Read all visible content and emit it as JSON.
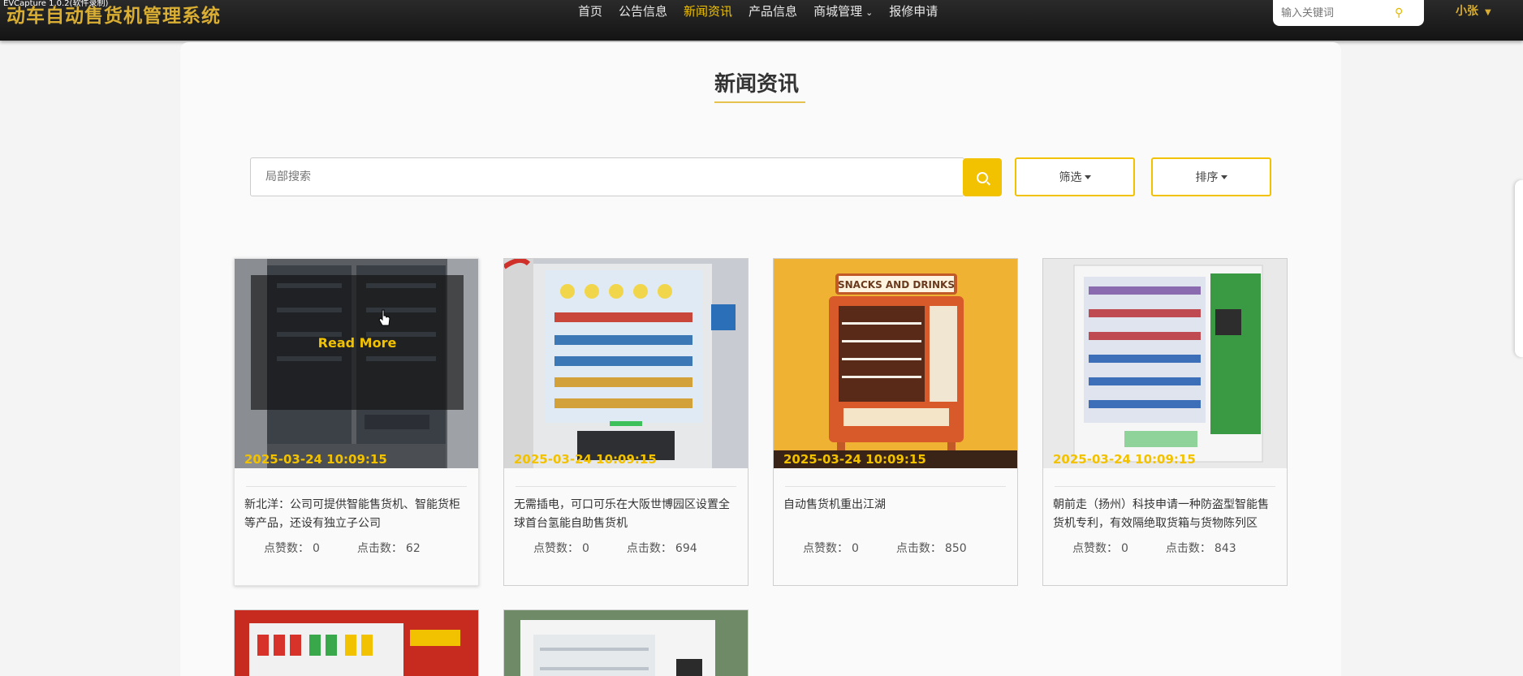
{
  "overlay": {
    "caption": "EVCapture 1.0.2(软件录制)"
  },
  "header": {
    "brand": "动车自动售货机管理系统",
    "nav": [
      {
        "label": "首页"
      },
      {
        "label": "公告信息"
      },
      {
        "label": "新闻资讯"
      },
      {
        "label": "产品信息"
      },
      {
        "label": "商城管理"
      },
      {
        "label": "报修申请"
      }
    ],
    "search_placeholder": "输入关键词",
    "user": "小张"
  },
  "page": {
    "title": "新闻资讯",
    "search_placeholder": "局部搜索",
    "filter_label": "筛选",
    "sort_label": "排序"
  },
  "cards": [
    {
      "date": "2025-03-24 10:09:15",
      "title": "新北洋：公司可提供智能售货机、智能货柜等产品，还设有独立子公司",
      "likes_label": "点赞数：",
      "likes": "0",
      "clicks_label": "点击数：",
      "clicks": "62",
      "hover_text": "Read More"
    },
    {
      "date": "2025-03-24 10:09:15",
      "title": "无需插电，可口可乐在大阪世博园区设置全球首台氢能自助售货机",
      "likes_label": "点赞数：",
      "likes": "0",
      "clicks_label": "点击数：",
      "clicks": "694"
    },
    {
      "date": "2025-03-24 10:09:15",
      "title": "自动售货机重出江湖",
      "likes_label": "点赞数：",
      "likes": "0",
      "clicks_label": "点击数：",
      "clicks": "850",
      "image_text": "SNACKS AND DRINKS"
    },
    {
      "date": "2025-03-24 10:09:15",
      "title": "朝前走（扬州）科技申请一种防盗型智能售货机专利，有效隔绝取货箱与货物陈列区",
      "likes_label": "点赞数：",
      "likes": "0",
      "clicks_label": "点击数：",
      "clicks": "843"
    }
  ],
  "colors": {
    "accent": "#f2c200",
    "brand": "#d9ae32",
    "nav_bg": "#1a1a1a"
  }
}
